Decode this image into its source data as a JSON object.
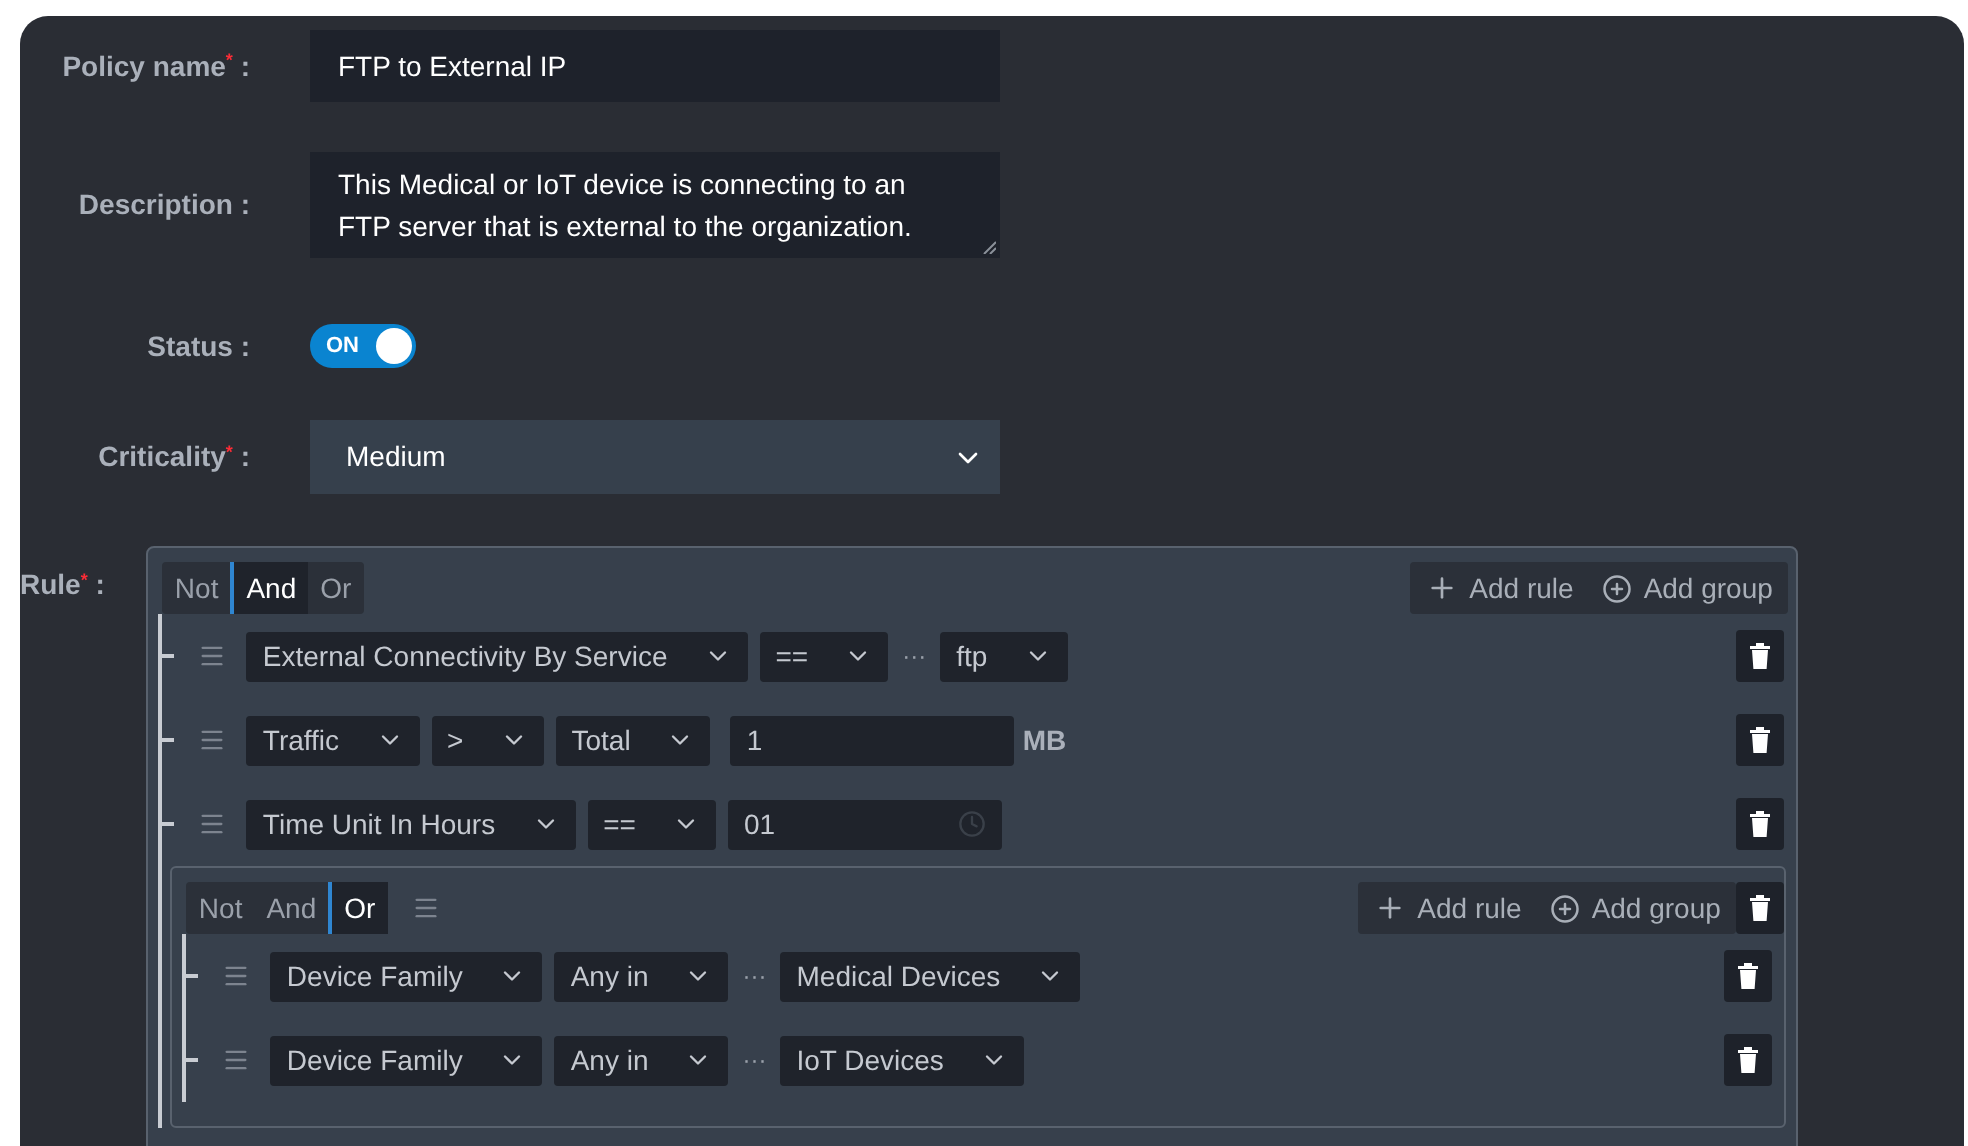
{
  "form": {
    "policy_name": {
      "label": "Policy name$^{*}$ :",
      "value": "FTP to External IP"
    },
    "description": {
      "label": "Description :",
      "value": "This Medical or IoT device is connecting to an FTP server that is external to the organization."
    },
    "status": {
      "label": "Status :",
      "on": true,
      "text": "ON"
    },
    "criticality": {
      "label": "Criticality$^{*}$ :",
      "value": "Medium"
    },
    "rule": {
      "label": "Rule$^{*}$ :",
      "group": {
        "handle": false,
        "deletable": false,
        "combinators": [
          {
            "label": "Not",
            "selected": false
          },
          {
            "label": "And",
            "selected": true
          },
          {
            "label": "Or",
            "selected": false
          }
        ],
        "add_rule": "Add rule",
        "add_group": "Add group",
        "children": [
          {
            "kind": "rule",
            "parts": [
              {
                "kind": "select",
                "value": "External Connectivity By Service"
              },
              {
                "kind": "select",
                "value": "=="
              },
              {
                "kind": "dots",
                "value": "···"
              },
              {
                "kind": "select",
                "value": "ftp"
              }
            ]
          },
          {
            "kind": "rule",
            "parts": [
              {
                "kind": "select",
                "value": "Traffic"
              },
              {
                "kind": "select",
                "value": ">"
              },
              {
                "kind": "select",
                "value": "Total"
              },
              {
                "kind": "input",
                "value": "1"
              },
              {
                "kind": "unit",
                "value": "MB"
              }
            ]
          },
          {
            "kind": "rule",
            "parts": [
              {
                "kind": "select",
                "value": "Time Unit In Hours"
              },
              {
                "kind": "select",
                "value": "=="
              },
              {
                "kind": "time",
                "value": "01"
              }
            ]
          },
          {
            "kind": "group",
            "handle": true,
            "deletable": true,
            "combinators": [
              {
                "label": "Not",
                "selected": false
              },
              {
                "label": "And",
                "selected": false
              },
              {
                "label": "Or",
                "selected": true
              }
            ],
            "add_rule": "Add rule",
            "add_group": "Add group",
            "children": [
              {
                "kind": "rule",
                "parts": [
                  {
                    "kind": "select",
                    "value": "Device Family"
                  },
                  {
                    "kind": "select",
                    "value": "Any in"
                  },
                  {
                    "kind": "dots",
                    "value": "···"
                  },
                  {
                    "kind": "select",
                    "value": "Medical Devices"
                  }
                ]
              },
              {
                "kind": "rule",
                "parts": [
                  {
                    "kind": "select",
                    "value": "Device Family"
                  },
                  {
                    "kind": "select",
                    "value": "Any in"
                  },
                  {
                    "kind": "dots",
                    "value": "···"
                  },
                  {
                    "kind": "select",
                    "value": "IoT Devices"
                  }
                ]
              }
            ]
          }
        ]
      }
    }
  }
}
